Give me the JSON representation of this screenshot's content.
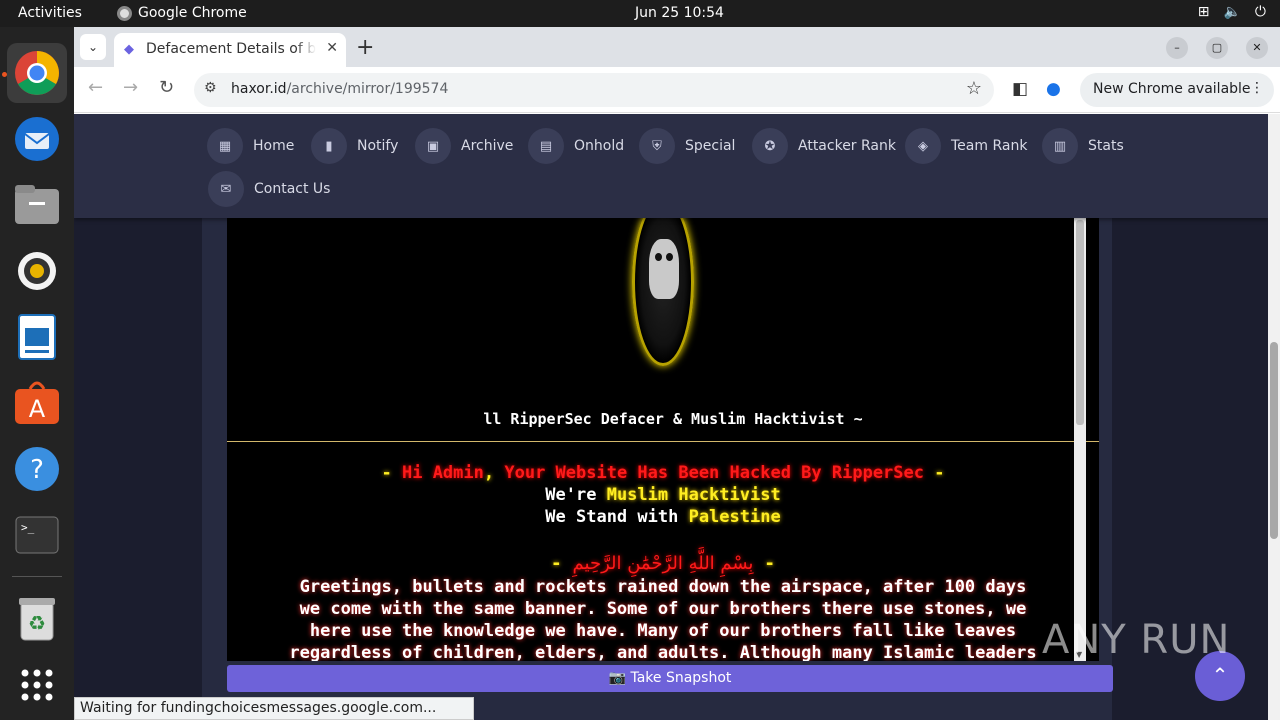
{
  "topbar": {
    "activities": "Activities",
    "app_name": "Google Chrome",
    "clock": "Jun 25  10:54"
  },
  "dock": {
    "items": [
      "chrome-icon",
      "thunderbird-icon",
      "files-icon",
      "rhythmbox-icon",
      "writer-icon",
      "app-center-icon",
      "help-icon",
      "terminal-icon",
      "trash-icon",
      "show-apps-icon"
    ]
  },
  "browser": {
    "tab_title": "Defacement Details of b",
    "url_host": "haxor.id",
    "url_path": "/archive/mirror/199574",
    "update_label": "New Chrome available",
    "status_text": "Waiting for fundingchoicesmessages.google.com..."
  },
  "site_nav": {
    "items": [
      {
        "label": "Home",
        "icon": "grid-icon"
      },
      {
        "label": "Notify",
        "icon": "bookmark-icon"
      },
      {
        "label": "Archive",
        "icon": "archive-icon"
      },
      {
        "label": "Onhold",
        "icon": "document-icon"
      },
      {
        "label": "Special",
        "icon": "shield-icon"
      },
      {
        "label": "Attacker Rank",
        "icon": "award-icon"
      },
      {
        "label": "Team Rank",
        "icon": "layers-icon"
      },
      {
        "label": "Stats",
        "icon": "chart-icon"
      },
      {
        "label": "Contact Us",
        "icon": "mail-icon"
      }
    ]
  },
  "mirror": {
    "caption": "ll RipperSec Defacer & Muslim Hacktivist ~",
    "line1": {
      "dash1": "- ",
      "p1": "Hi Admin",
      "c1": ", ",
      "p2": "Your Website Has Been Hacked By RipperSec",
      "dash2": " -"
    },
    "line2": {
      "p1": "We're ",
      "p2": "Muslim Hacktivist"
    },
    "line3": {
      "p1": "We Stand with ",
      "p2": "Palestine"
    },
    "line4": {
      "dash1": "- ",
      "arabic": "بِسْمِ اللَّهِ الرَّحْمَٰنِ الرَّحِيمِ",
      "dash2": " -"
    },
    "greeting": [
      "Greetings, bullets and rockets rained down the airspace, after 100 days",
      "we come with the same banner. Some of our brothers there use stones, we",
      "here use the knowledge we have. Many of our brothers fall like leaves",
      "regardless of children, elders, and adults. Although many Islamic leaders"
    ]
  },
  "snapshot_label": "Take Snapshot",
  "watermark": "ANY RUN"
}
